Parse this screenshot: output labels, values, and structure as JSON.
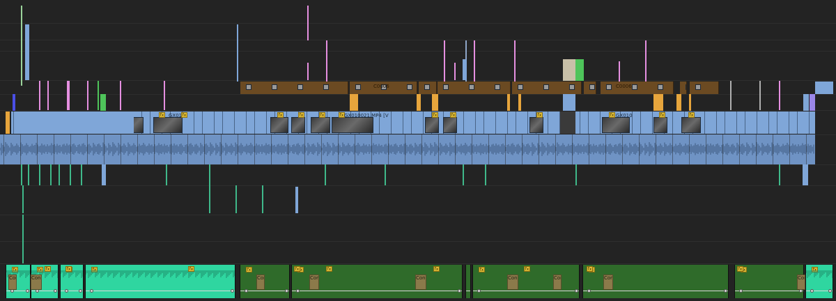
{
  "timeline": {
    "video_clip_labels": [
      "GX01",
      "GX010021.MP4 [V",
      "GX010"
    ],
    "brown_clip_labels": [
      "C0006",
      "C0006"
    ],
    "fx_badge": "fx",
    "const_label": "Const"
  },
  "colors": {
    "background": "#232323",
    "video_clip": "#7fa6d8",
    "audio_clip": "#6f93c4",
    "brown_clip": "#6b4a22",
    "orange_clip": "#e7a53c",
    "pink_marker": "#e58fe0",
    "teal_audio": "#2fd6a0",
    "green_audio": "#2f6b2a",
    "graphic_green": "#4ec45a",
    "purple_marker": "#9a86e8",
    "blue_marker": "#4a4fe6"
  }
}
